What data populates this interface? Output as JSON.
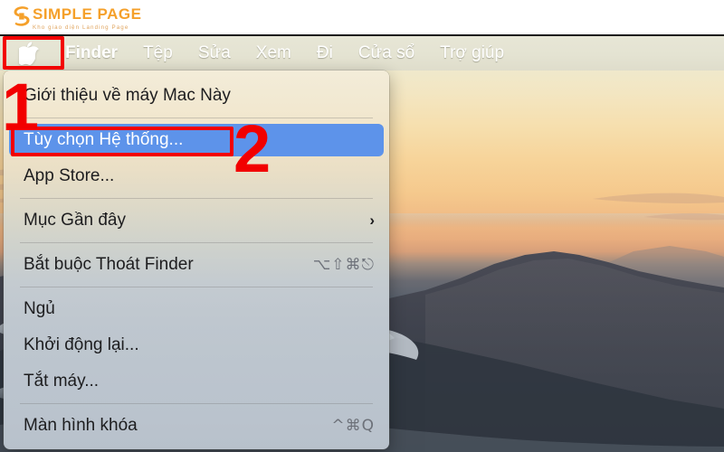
{
  "watermark": {
    "brand": "SIMPLE PAGE",
    "tagline": "Kho giao diện Landing Page",
    "brand_color": "#f5a02a",
    "tagline_color": "#e0a45e",
    "logo_icon": "stylized-s-logo-icon"
  },
  "menubar": {
    "apple_icon": "apple-logo-icon",
    "items": [
      {
        "label": "Finder",
        "bold": true
      },
      {
        "label": "Tệp",
        "bold": false
      },
      {
        "label": "Sửa",
        "bold": false
      },
      {
        "label": "Xem",
        "bold": false
      },
      {
        "label": "Đi",
        "bold": false
      },
      {
        "label": "Cửa sổ",
        "bold": false
      },
      {
        "label": "Trợ giúp",
        "bold": false
      }
    ],
    "background_color": "#e4e3d2",
    "text_color": "#ffffff"
  },
  "apple_menu": {
    "highlight_color": "#5d93ea",
    "items": [
      {
        "label": "Giới thiệu về máy Mac Này",
        "shortcut": "",
        "submenu": false,
        "selected": false
      },
      {
        "label": "Tùy chọn Hệ thống...",
        "shortcut": "",
        "submenu": false,
        "selected": true
      },
      {
        "label": "App Store...",
        "shortcut": "",
        "submenu": false,
        "selected": false
      },
      {
        "label": "Mục Gần đây",
        "shortcut": "",
        "submenu": true,
        "selected": false
      },
      {
        "label": "Bắt buộc Thoát Finder",
        "shortcut": "⌥⇧⌘⎋",
        "submenu": false,
        "selected": false
      },
      {
        "label": "Ngủ",
        "shortcut": "",
        "submenu": false,
        "selected": false
      },
      {
        "label": "Khởi động lại...",
        "shortcut": "",
        "submenu": false,
        "selected": false
      },
      {
        "label": "Tắt máy...",
        "shortcut": "",
        "submenu": false,
        "selected": false
      },
      {
        "label": "Màn hình khóa",
        "shortcut": "^⌘Q",
        "submenu": false,
        "selected": false
      }
    ],
    "submenu_arrow": "›"
  },
  "annotations": {
    "color": "#f20000",
    "step1": "1",
    "step2": "2"
  },
  "desktop": {
    "wallpaper_description": "Sunset mountain ridge above a sea of clouds"
  }
}
